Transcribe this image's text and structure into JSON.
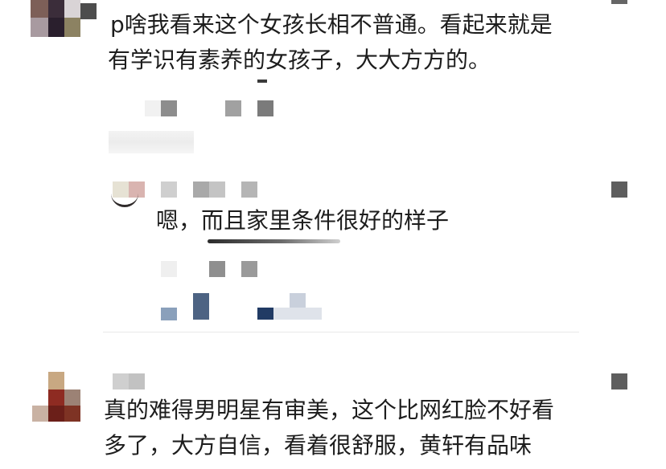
{
  "colors": {
    "background": "#ffffff",
    "text": "#1d1d1d",
    "divider": "#e8e8e8"
  },
  "comments": {
    "first": {
      "line_1": "p啥我看来这个女孩长相不普通。看起来就是",
      "line_2": "有学识有素养的女孩子，大大方方的。",
      "reply": {
        "text": "嗯，而且家里条件很好的样子"
      }
    },
    "second": {
      "line_1": "真的难得男明星有审美，这个比网红脸不好看",
      "line_2": "多了，大方自信，看着很舒服，黄轩有品味"
    }
  }
}
